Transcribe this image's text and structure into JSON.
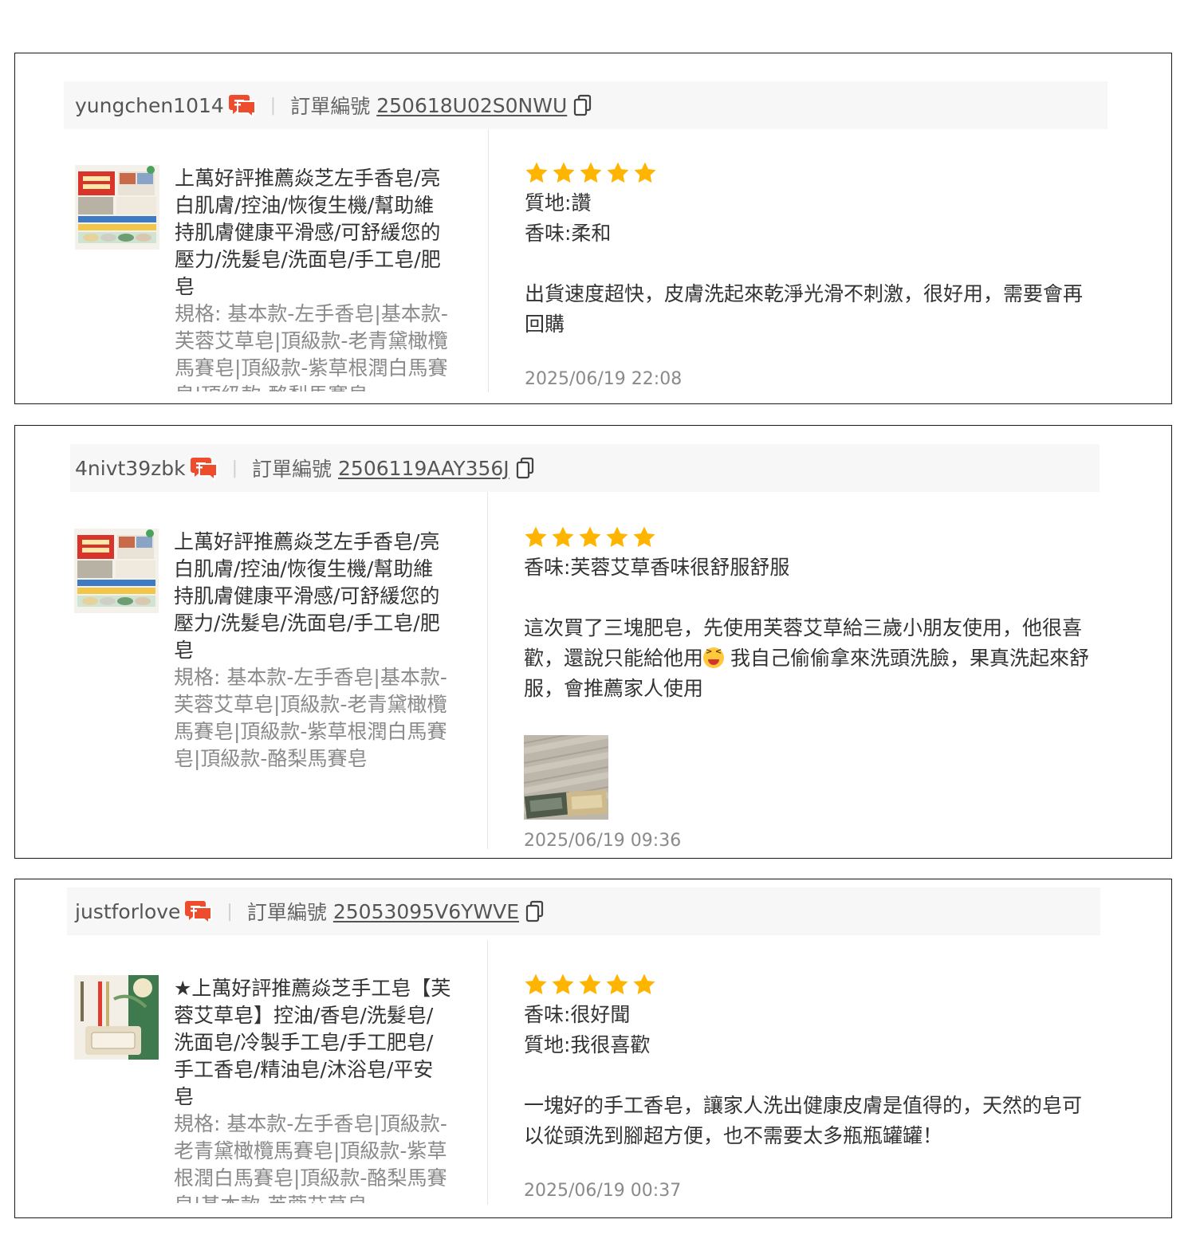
{
  "reviews": [
    {
      "username": "yungchen1014",
      "order_label": "訂單編號",
      "order_no": "250618U02S0NWU",
      "product_name": "上萬好評推薦焱芝左手香皂/亮白肌膚/控油/恢復生機/幫助維持肌膚健康平滑感/可舒緩您的壓力/洗髮皂/洗面皂/手工皂/肥皂",
      "spec": "規格: 基本款-左手香皂|基本款-芙蓉艾草皂|頂級款-老青黛橄欖馬賽皂|頂級款-紫草根潤白馬賽皂|頂級款-酪梨馬賽皂",
      "rating": 5,
      "attributes": [
        "質地:讚",
        "香味:柔和"
      ],
      "comment": "出貨速度超快，皮膚洗起來乾淨光滑不刺激，很好用，需要會再回購",
      "time": "2025/06/19 22:08"
    },
    {
      "username": "4nivt39zbk",
      "order_label": "訂單編號",
      "order_no": "2506119AAY356J",
      "product_name": "上萬好評推薦焱芝左手香皂/亮白肌膚/控油/恢復生機/幫助維持肌膚健康平滑感/可舒緩您的壓力/洗髮皂/洗面皂/手工皂/肥皂",
      "spec": "規格: 基本款-左手香皂|基本款-芙蓉艾草皂|頂級款-老青黛橄欖馬賽皂|頂級款-紫草根潤白馬賽皂|頂級款-酪梨馬賽皂",
      "rating": 5,
      "attributes": [
        "香味:芙蓉艾草香味很舒服舒服"
      ],
      "comment_before_emoji": "這次買了三塊肥皂，先使用芙蓉艾草給三歲小朋友使用，他很喜歡，還說只能給他用",
      "comment_after_emoji": "我自己偷偷拿來洗頭洗臉，果真洗起來舒服，會推薦家人使用",
      "time": "2025/06/19 09:36"
    },
    {
      "username": "justforlove",
      "order_label": "訂單編號",
      "order_no": "25053095V6YWVE",
      "product_name": "★上萬好評推薦焱芝手工皂【芙蓉艾草皂】控油/香皂/洗髮皂/洗面皂/冷製手工皂/手工肥皂/手工香皂/精油皂/沐浴皂/平安皂",
      "spec": "規格: 基本款-左手香皂|頂級款-老青黛橄欖馬賽皂|頂級款-紫草根潤白馬賽皂|頂級款-酪梨馬賽皂|基本款-芙蓉艾草皂",
      "rating": 5,
      "attributes": [
        "香味:很好聞",
        "質地:我很喜歡"
      ],
      "comment": "一塊好的手工香皂，讓家人洗出健康皮膚是值得的，￼天然的皂可以從頭洗到腳超方便，也不需要太多瓶瓶罐罐！",
      "time": "2025/06/19 00:37"
    }
  ],
  "colors": {
    "accent": "#ee4d2d",
    "star": "#ffb400"
  },
  "icons": {
    "chat": "chat-bubble-icon",
    "copy": "copy-icon",
    "star": "star-icon",
    "emoji": "laughing-face-emoji"
  }
}
